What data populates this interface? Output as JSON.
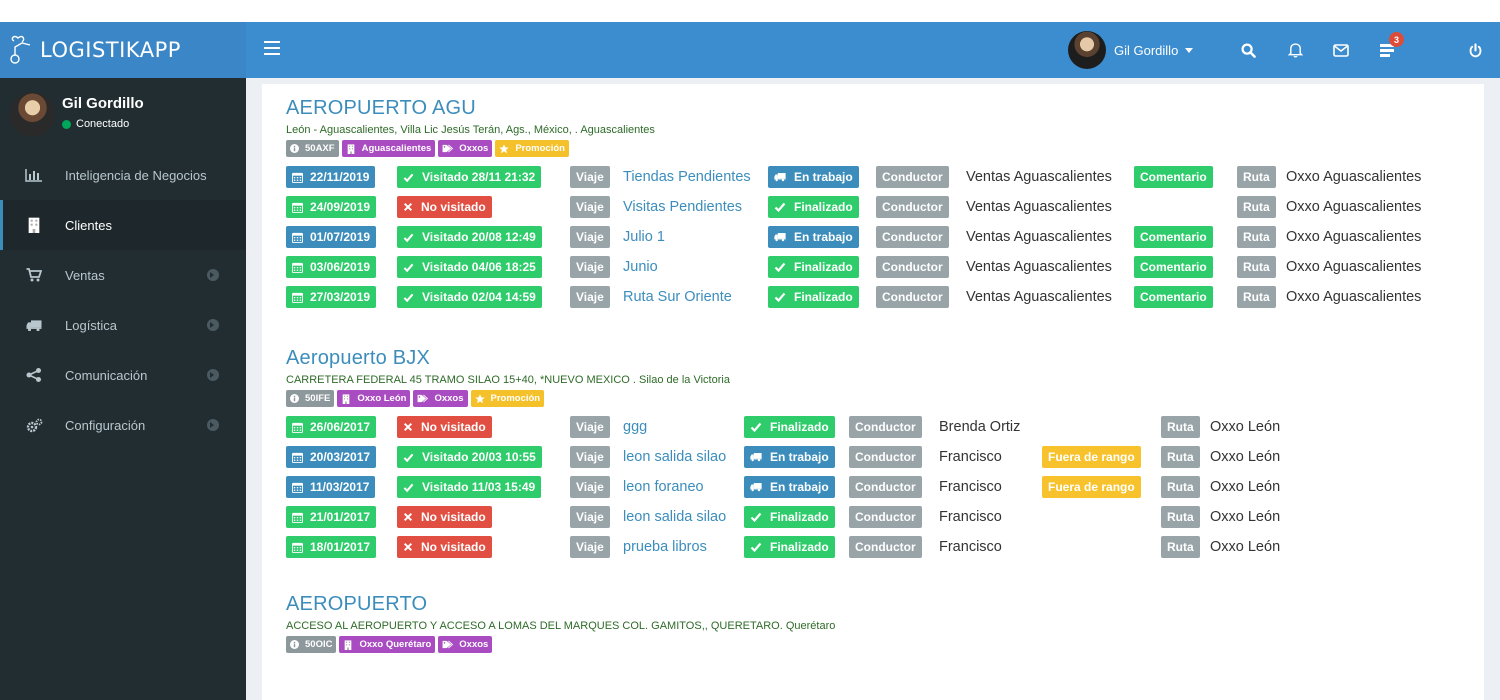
{
  "app": {
    "brand": "LOGISTIKAPP"
  },
  "header": {
    "user_name": "Gil Gordillo",
    "tasks_count": "3"
  },
  "sidebar": {
    "user_name": "Gil Gordillo",
    "user_status": "Conectado",
    "items": [
      {
        "label": "Inteligencia de Negocios",
        "icon": "bar-chart-icon",
        "active": false,
        "expandable": false
      },
      {
        "label": "Clientes",
        "icon": "building-icon",
        "active": true,
        "expandable": false
      },
      {
        "label": "Ventas",
        "icon": "cart-icon",
        "active": false,
        "expandable": true
      },
      {
        "label": "Logística",
        "icon": "truck-icon",
        "active": false,
        "expandable": true
      },
      {
        "label": "Comunicación",
        "icon": "share-icon",
        "active": false,
        "expandable": true
      },
      {
        "label": "Configuración",
        "icon": "gears-icon",
        "active": false,
        "expandable": true
      }
    ]
  },
  "clients": [
    {
      "name": "AEROPUERTO AGU",
      "address": "León - Aguascalientes, Villa Lic Jesús Terán, Ags., México, . Aguascalientes",
      "tags": [
        {
          "text": "50AXF",
          "color": "gray",
          "icon": "info-icon"
        },
        {
          "text": "Aguascalientes",
          "color": "purple",
          "icon": "building-icon"
        },
        {
          "text": "Oxxos",
          "color": "purple",
          "icon": "tag-icon"
        },
        {
          "text": "Promoción",
          "color": "yellow",
          "icon": "star-icon"
        }
      ],
      "visits": [
        {
          "date": "22/11/2019",
          "date_color": "blue",
          "visit_status": "Visitado 28/11 21:32",
          "visited": true,
          "trip_label": "Viaje",
          "trip": "Tiendas Pendientes",
          "state": "En trabajo",
          "state_type": "working",
          "driver_label": "Conductor",
          "driver": "Ventas Aguascalientes",
          "extra": "Comentario",
          "extra_type": "comment",
          "route_label": "Ruta",
          "route": "Oxxo Aguascalientes"
        },
        {
          "date": "24/09/2019",
          "date_color": "green",
          "visit_status": "No visitado",
          "visited": false,
          "trip_label": "Viaje",
          "trip": "Visitas Pendientes",
          "state": "Finalizado",
          "state_type": "done",
          "driver_label": "Conductor",
          "driver": "Ventas Aguascalientes",
          "extra": "",
          "extra_type": "",
          "route_label": "Ruta",
          "route": "Oxxo Aguascalientes"
        },
        {
          "date": "01/07/2019",
          "date_color": "blue",
          "visit_status": "Visitado 20/08 12:49",
          "visited": true,
          "trip_label": "Viaje",
          "trip": "Julio 1",
          "state": "En trabajo",
          "state_type": "working",
          "driver_label": "Conductor",
          "driver": "Ventas Aguascalientes",
          "extra": "Comentario",
          "extra_type": "comment",
          "route_label": "Ruta",
          "route": "Oxxo Aguascalientes"
        },
        {
          "date": "03/06/2019",
          "date_color": "green",
          "visit_status": "Visitado 04/06 18:25",
          "visited": true,
          "trip_label": "Viaje",
          "trip": "Junio",
          "state": "Finalizado",
          "state_type": "done",
          "driver_label": "Conductor",
          "driver": "Ventas Aguascalientes",
          "extra": "Comentario",
          "extra_type": "comment",
          "route_label": "Ruta",
          "route": "Oxxo Aguascalientes"
        },
        {
          "date": "27/03/2019",
          "date_color": "green",
          "visit_status": "Visitado 02/04 14:59",
          "visited": true,
          "trip_label": "Viaje",
          "trip": "Ruta Sur Oriente",
          "state": "Finalizado",
          "state_type": "done",
          "driver_label": "Conductor",
          "driver": "Ventas Aguascalientes",
          "extra": "Comentario",
          "extra_type": "comment",
          "route_label": "Ruta",
          "route": "Oxxo Aguascalientes"
        }
      ]
    },
    {
      "name": "Aeropuerto BJX",
      "address": "CARRETERA FEDERAL 45 TRAMO SILAO 15+40, *NUEVO MEXICO . Silao de la Victoria",
      "tags": [
        {
          "text": "50IFE",
          "color": "gray",
          "icon": "info-icon"
        },
        {
          "text": "Oxxo León",
          "color": "purple",
          "icon": "building-icon"
        },
        {
          "text": "Oxxos",
          "color": "purple",
          "icon": "tag-icon"
        },
        {
          "text": "Promoción",
          "color": "yellow",
          "icon": "star-icon"
        }
      ],
      "visits": [
        {
          "date": "26/06/2017",
          "date_color": "green",
          "visit_status": "No visitado",
          "visited": false,
          "trip_label": "Viaje",
          "trip": "ggg",
          "state": "Finalizado",
          "state_type": "done",
          "driver_label": "Conductor",
          "driver": "Brenda Ortiz",
          "extra": "",
          "extra_type": "",
          "route_label": "Ruta",
          "route": "Oxxo León"
        },
        {
          "date": "20/03/2017",
          "date_color": "blue",
          "visit_status": "Visitado 20/03 10:55",
          "visited": true,
          "trip_label": "Viaje",
          "trip": "leon salida silao",
          "state": "En trabajo",
          "state_type": "working",
          "driver_label": "Conductor",
          "driver": "Francisco",
          "extra": "Fuera de rango",
          "extra_type": "range",
          "route_label": "Ruta",
          "route": "Oxxo León"
        },
        {
          "date": "11/03/2017",
          "date_color": "blue",
          "visit_status": "Visitado 11/03 15:49",
          "visited": true,
          "trip_label": "Viaje",
          "trip": "leon foraneo",
          "state": "En trabajo",
          "state_type": "working",
          "driver_label": "Conductor",
          "driver": "Francisco",
          "extra": "Fuera de rango",
          "extra_type": "range",
          "route_label": "Ruta",
          "route": "Oxxo León"
        },
        {
          "date": "21/01/2017",
          "date_color": "green",
          "visit_status": "No visitado",
          "visited": false,
          "trip_label": "Viaje",
          "trip": "leon salida silao",
          "state": "Finalizado",
          "state_type": "done",
          "driver_label": "Conductor",
          "driver": "Francisco",
          "extra": "",
          "extra_type": "",
          "route_label": "Ruta",
          "route": "Oxxo León"
        },
        {
          "date": "18/01/2017",
          "date_color": "green",
          "visit_status": "No visitado",
          "visited": false,
          "trip_label": "Viaje",
          "trip": "prueba libros",
          "state": "Finalizado",
          "state_type": "done",
          "driver_label": "Conductor",
          "driver": "Francisco",
          "extra": "",
          "extra_type": "",
          "route_label": "Ruta",
          "route": "Oxxo León"
        }
      ]
    },
    {
      "name": "AEROPUERTO",
      "address": "ACCESO AL AEROPUERTO Y ACCESO A LOMAS DEL MARQUES COL. GAMITOS,, QUERETARO. Querétaro",
      "tags": [
        {
          "text": "50OIC",
          "color": "gray",
          "icon": "info-icon"
        },
        {
          "text": "Oxxo Querétaro",
          "color": "purple",
          "icon": "building-icon"
        },
        {
          "text": "Oxxos",
          "color": "purple",
          "icon": "tag-icon"
        }
      ],
      "visits": []
    }
  ]
}
